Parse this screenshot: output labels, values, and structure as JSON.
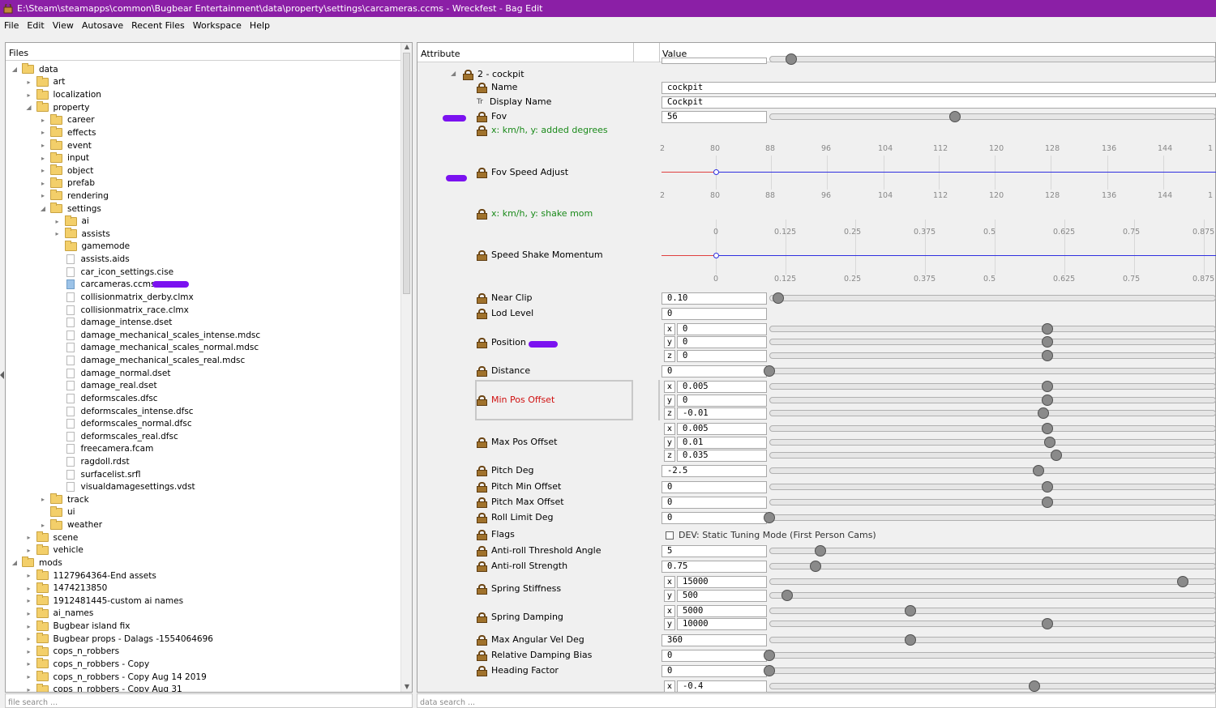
{
  "window": {
    "title": "E:\\Steam\\steamapps\\common\\Bugbear Entertainment\\data\\property\\settings\\carcameras.ccms - Wreckfest - Bag Edit"
  },
  "menu": [
    "File",
    "Edit",
    "View",
    "Autosave",
    "Recent Files",
    "Workspace",
    "Help"
  ],
  "files": {
    "header": "Files",
    "search_placeholder": "file search ...",
    "tree": [
      {
        "label": "data",
        "depth": 0,
        "kind": "folder",
        "exp": "open"
      },
      {
        "label": "art",
        "depth": 1,
        "kind": "folder",
        "exp": "closed"
      },
      {
        "label": "localization",
        "depth": 1,
        "kind": "folder",
        "exp": "closed"
      },
      {
        "label": "property",
        "depth": 1,
        "kind": "folder",
        "exp": "open"
      },
      {
        "label": "career",
        "depth": 2,
        "kind": "folder",
        "exp": "closed"
      },
      {
        "label": "effects",
        "depth": 2,
        "kind": "folder",
        "exp": "closed"
      },
      {
        "label": "event",
        "depth": 2,
        "kind": "folder",
        "exp": "closed"
      },
      {
        "label": "input",
        "depth": 2,
        "kind": "folder",
        "exp": "closed"
      },
      {
        "label": "object",
        "depth": 2,
        "kind": "folder",
        "exp": "closed"
      },
      {
        "label": "prefab",
        "depth": 2,
        "kind": "folder",
        "exp": "closed"
      },
      {
        "label": "rendering",
        "depth": 2,
        "kind": "folder",
        "exp": "closed"
      },
      {
        "label": "settings",
        "depth": 2,
        "kind": "folder",
        "exp": "open"
      },
      {
        "label": "ai",
        "depth": 3,
        "kind": "folder",
        "exp": "closed"
      },
      {
        "label": "assists",
        "depth": 3,
        "kind": "folder",
        "exp": "closed"
      },
      {
        "label": "gamemode",
        "depth": 3,
        "kind": "folder",
        "exp": ""
      },
      {
        "label": "assists.aids",
        "depth": 3,
        "kind": "file",
        "exp": ""
      },
      {
        "label": "car_icon_settings.cise",
        "depth": 3,
        "kind": "file",
        "exp": ""
      },
      {
        "label": "carcameras.ccms",
        "depth": 3,
        "kind": "file-selected",
        "exp": ""
      },
      {
        "label": "collisionmatrix_derby.clmx",
        "depth": 3,
        "kind": "file",
        "exp": ""
      },
      {
        "label": "collisionmatrix_race.clmx",
        "depth": 3,
        "kind": "file",
        "exp": ""
      },
      {
        "label": "damage_intense.dset",
        "depth": 3,
        "kind": "file",
        "exp": ""
      },
      {
        "label": "damage_mechanical_scales_intense.mdsc",
        "depth": 3,
        "kind": "file",
        "exp": ""
      },
      {
        "label": "damage_mechanical_scales_normal.mdsc",
        "depth": 3,
        "kind": "file",
        "exp": ""
      },
      {
        "label": "damage_mechanical_scales_real.mdsc",
        "depth": 3,
        "kind": "file",
        "exp": ""
      },
      {
        "label": "damage_normal.dset",
        "depth": 3,
        "kind": "file",
        "exp": ""
      },
      {
        "label": "damage_real.dset",
        "depth": 3,
        "kind": "file",
        "exp": ""
      },
      {
        "label": "deformscales.dfsc",
        "depth": 3,
        "kind": "file",
        "exp": ""
      },
      {
        "label": "deformscales_intense.dfsc",
        "depth": 3,
        "kind": "file",
        "exp": ""
      },
      {
        "label": "deformscales_normal.dfsc",
        "depth": 3,
        "kind": "file",
        "exp": ""
      },
      {
        "label": "deformscales_real.dfsc",
        "depth": 3,
        "kind": "file",
        "exp": ""
      },
      {
        "label": "freecamera.fcam",
        "depth": 3,
        "kind": "file",
        "exp": ""
      },
      {
        "label": "ragdoll.rdst",
        "depth": 3,
        "kind": "file",
        "exp": ""
      },
      {
        "label": "surfacelist.srfl",
        "depth": 3,
        "kind": "file",
        "exp": ""
      },
      {
        "label": "visualdamagesettings.vdst",
        "depth": 3,
        "kind": "file",
        "exp": ""
      },
      {
        "label": "track",
        "depth": 2,
        "kind": "folder",
        "exp": "closed"
      },
      {
        "label": "ui",
        "depth": 2,
        "kind": "folder",
        "exp": ""
      },
      {
        "label": "weather",
        "depth": 2,
        "kind": "folder",
        "exp": "closed"
      },
      {
        "label": "scene",
        "depth": 1,
        "kind": "folder",
        "exp": "closed"
      },
      {
        "label": "vehicle",
        "depth": 1,
        "kind": "folder",
        "exp": "closed"
      },
      {
        "label": "mods",
        "depth": 0,
        "kind": "folder",
        "exp": "open"
      },
      {
        "label": "1127964364-End assets",
        "depth": 1,
        "kind": "folder",
        "exp": "closed"
      },
      {
        "label": "1474213850",
        "depth": 1,
        "kind": "folder",
        "exp": "closed"
      },
      {
        "label": "1912481445-custom ai names",
        "depth": 1,
        "kind": "folder",
        "exp": "closed"
      },
      {
        "label": "ai_names",
        "depth": 1,
        "kind": "folder",
        "exp": "closed"
      },
      {
        "label": "Bugbear island fix",
        "depth": 1,
        "kind": "folder",
        "exp": "closed"
      },
      {
        "label": "Bugbear props - Dalags -1554064696",
        "depth": 1,
        "kind": "folder",
        "exp": "closed"
      },
      {
        "label": "cops_n_robbers",
        "depth": 1,
        "kind": "folder",
        "exp": "closed"
      },
      {
        "label": "cops_n_robbers - Copy",
        "depth": 1,
        "kind": "folder",
        "exp": "closed"
      },
      {
        "label": "cops_n_robbers - Copy Aug 14 2019",
        "depth": 1,
        "kind": "folder",
        "exp": "closed"
      },
      {
        "label": "cops_n_robbers - Copy Aug 31",
        "depth": 1,
        "kind": "folder",
        "exp": "closed"
      }
    ]
  },
  "attributes": {
    "col_attribute": "Attribute",
    "col_value": "Value",
    "search_placeholder": "data search ...",
    "node_label": "2 - cockpit",
    "name": {
      "label": "Name",
      "value": "cockpit"
    },
    "display_name": {
      "label": "Display Name",
      "type_glyph": "Tr",
      "value": "Cockpit"
    },
    "fov": {
      "label": "Fov",
      "value": "56",
      "slider": 0.42
    },
    "fov_speed_hint": "x: km/h, y: added degrees",
    "fov_speed": {
      "label": "Fov Speed Adjust",
      "ticks": [
        "2",
        "80",
        "88",
        "96",
        "104",
        "112",
        "120",
        "128",
        "136",
        "144",
        "1"
      ]
    },
    "shake_hint": "x: km/h, y: shake mom",
    "shake": {
      "label": "Speed Shake Momentum",
      "ticks": [
        "0",
        "0.125",
        "0.25",
        "0.375",
        "0.5",
        "0.625",
        "0.75",
        "0.875"
      ]
    },
    "near_clip": {
      "label": "Near Clip",
      "value": "0.10",
      "slider": 0.02
    },
    "lod_level": {
      "label": "Lod Level",
      "value": "0"
    },
    "position": {
      "label": "Position",
      "x": "0",
      "y": "0",
      "z": "0",
      "sx": 0.63,
      "sy": 0.63,
      "sz": 0.63
    },
    "distance": {
      "label": "Distance",
      "value": "0",
      "slider": 0.0
    },
    "min_pos": {
      "label": "Min Pos Offset",
      "x": "0.005",
      "y": "0",
      "z": "-0.01",
      "sx": 0.63,
      "sy": 0.63,
      "sz": 0.62
    },
    "max_pos": {
      "label": "Max Pos Offset",
      "x": "0.005",
      "y": "0.01",
      "z": "0.035",
      "sx": 0.63,
      "sy": 0.635,
      "sz": 0.65
    },
    "pitch_deg": {
      "label": "Pitch Deg",
      "value": "-2.5",
      "slider": 0.61
    },
    "pitch_min": {
      "label": "Pitch Min Offset",
      "value": "0",
      "slider": 0.63
    },
    "pitch_max": {
      "label": "Pitch Max Offset",
      "value": "0",
      "slider": 0.63
    },
    "roll_limit": {
      "label": "Roll Limit Deg",
      "value": "0",
      "slider": 0.0
    },
    "flags": {
      "label": "Flags",
      "checkbox": "DEV: Static Tuning Mode (First Person Cams)"
    },
    "antiroll_angle": {
      "label": "Anti-roll Threshold Angle",
      "value": "5",
      "slider": 0.115
    },
    "antiroll_strength": {
      "label": "Anti-roll Strength",
      "value": "0.75",
      "slider": 0.105
    },
    "spring_stiff": {
      "label": "Spring Stiffness",
      "x": "15000",
      "y": "500",
      "sx": 0.935,
      "sy": 0.04
    },
    "spring_damp": {
      "label": "Spring Damping",
      "x": "5000",
      "y": "10000",
      "sx": 0.32,
      "sy": 0.63
    },
    "max_ang": {
      "label": "Max Angular Vel Deg",
      "value": "360",
      "slider": 0.32
    },
    "rel_damp": {
      "label": "Relative Damping Bias",
      "value": "0",
      "slider": 0.0
    },
    "heading": {
      "label": "Heading Factor",
      "value": "0",
      "slider": 0.0
    },
    "last_row": {
      "x": "-0.4",
      "slider": 0.6
    }
  },
  "colors": {
    "titlebar": "#8b1fa6",
    "annotation_mark": "#7b12f0",
    "hint_text": "#1a8a1a",
    "modified_text": "#d01010"
  }
}
